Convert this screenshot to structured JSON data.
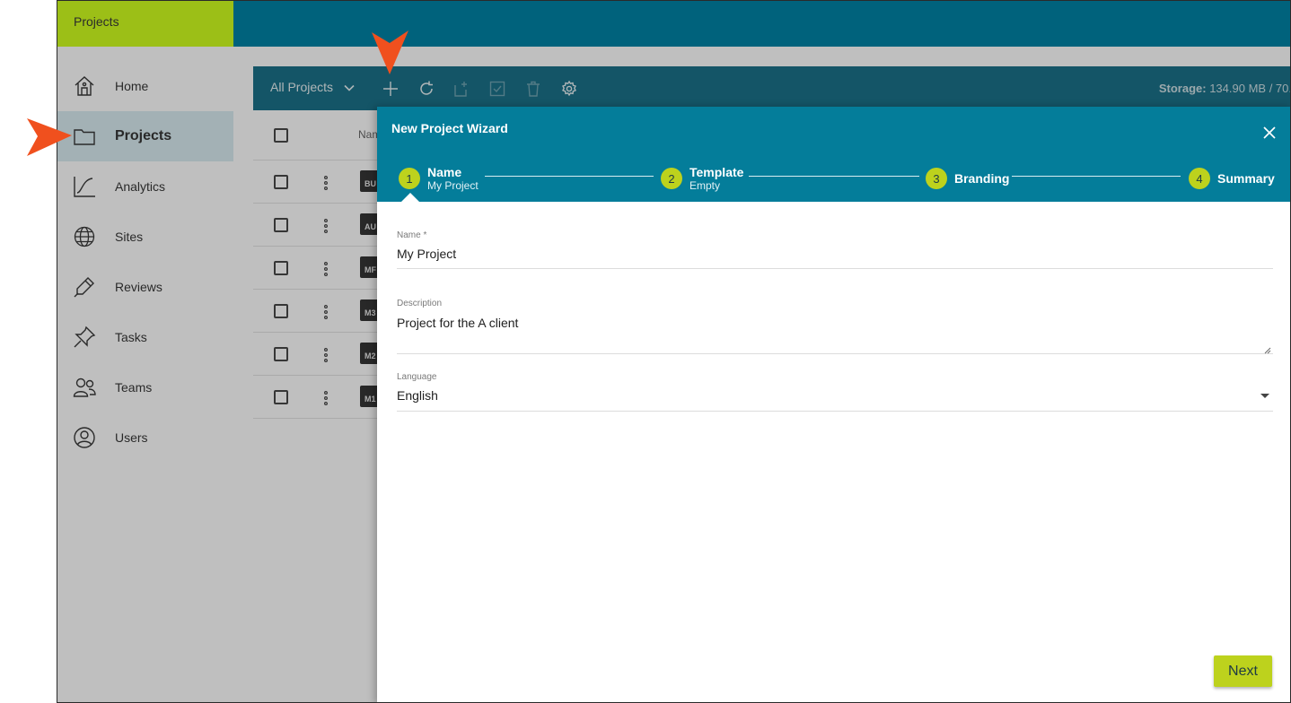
{
  "app": {
    "title": "Projects"
  },
  "sidebar": {
    "items": [
      {
        "label": "Home",
        "icon": "home-icon"
      },
      {
        "label": "Projects",
        "icon": "folder-icon",
        "active": true
      },
      {
        "label": "Analytics",
        "icon": "analytics-icon"
      },
      {
        "label": "Sites",
        "icon": "globe-icon"
      },
      {
        "label": "Reviews",
        "icon": "pen-icon"
      },
      {
        "label": "Tasks",
        "icon": "pin-icon"
      },
      {
        "label": "Teams",
        "icon": "team-icon"
      },
      {
        "label": "Users",
        "icon": "user-icon"
      }
    ]
  },
  "toolbar": {
    "filter_label": "All Projects",
    "storage_label": "Storage:",
    "storage_value": " 134.90 MB / 70."
  },
  "table": {
    "name_header": "Nam",
    "rows": [
      {
        "code": "BU"
      },
      {
        "code": "AU"
      },
      {
        "code": "MF"
      },
      {
        "code": "M3"
      },
      {
        "code": "M2"
      },
      {
        "code": "M1"
      }
    ]
  },
  "wizard": {
    "title": "New Project Wizard",
    "steps": [
      {
        "num": "1",
        "title": "Name",
        "sub": "My Project"
      },
      {
        "num": "2",
        "title": "Template",
        "sub": "Empty"
      },
      {
        "num": "3",
        "title": "Branding",
        "sub": ""
      },
      {
        "num": "4",
        "title": "Summary",
        "sub": ""
      }
    ],
    "fields": {
      "name_label": "Name *",
      "name_value": "My Project",
      "description_label": "Description",
      "description_value": "Project for the A client",
      "language_label": "Language",
      "language_value": "English"
    },
    "next_label": "Next"
  },
  "colors": {
    "header_teal": "#00627c",
    "brand_green": "#9cbf17",
    "dialog_teal": "#047d9a",
    "step_lime": "#bdd21d",
    "callout_orange": "#f0501e"
  }
}
